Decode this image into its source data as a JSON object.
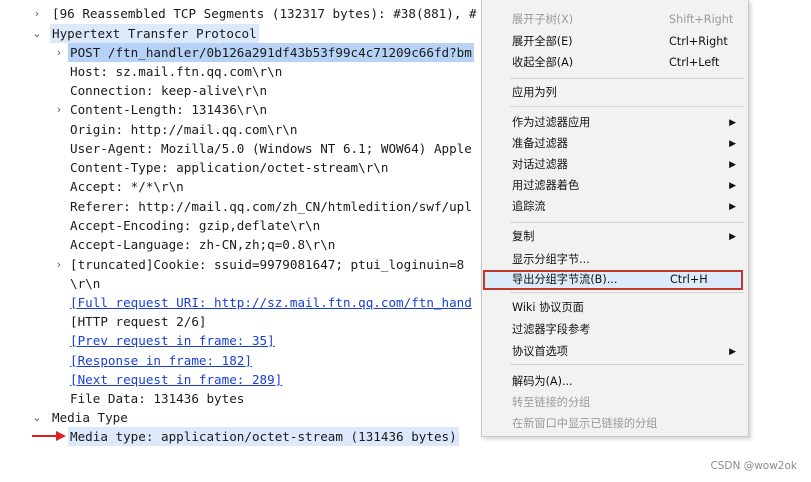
{
  "tree": [
    {
      "expander": "›",
      "text": "[96 Reassembled TCP Segments (132317 bytes): #38(881), #",
      "style": "plain"
    },
    {
      "expander": "⌄",
      "text": "Hypertext Transfer Protocol",
      "style": "sel-light"
    },
    {
      "expander": "›",
      "text": "POST /ftn_handler/0b126a291df43b53f99c4c71209c66fd?bm",
      "style": "sel-strong"
    },
    {
      "expander": "",
      "text": "Host: sz.mail.ftn.qq.com\\r\\n",
      "style": "plain"
    },
    {
      "expander": "",
      "text": "Connection: keep-alive\\r\\n",
      "style": "plain"
    },
    {
      "expander": "›",
      "text": "Content-Length: 131436\\r\\n",
      "style": "plain"
    },
    {
      "expander": "",
      "text": "Origin: http://mail.qq.com\\r\\n",
      "style": "plain"
    },
    {
      "expander": "",
      "text": "User-Agent: Mozilla/5.0 (Windows NT 6.1; WOW64) Apple",
      "style": "plain"
    },
    {
      "expander": "",
      "text": "Content-Type: application/octet-stream\\r\\n",
      "style": "plain"
    },
    {
      "expander": "",
      "text": "Accept: */*\\r\\n",
      "style": "plain"
    },
    {
      "expander": "",
      "text": "Referer: http://mail.qq.com/zh_CN/htmledition/swf/upl",
      "style": "plain"
    },
    {
      "expander": "",
      "text": "Accept-Encoding: gzip,deflate\\r\\n",
      "style": "plain"
    },
    {
      "expander": "",
      "text": "Accept-Language: zh-CN,zh;q=0.8\\r\\n",
      "style": "plain"
    },
    {
      "expander": "›",
      "text": " [truncated]Cookie: ssuid=9979081647; ptui_loginuin=8",
      "style": "plain"
    },
    {
      "expander": "",
      "text": "\\r\\n",
      "style": "plain"
    },
    {
      "expander": "",
      "text": "[Full request URI: http://sz.mail.ftn.qq.com/ftn_hand",
      "style": "link"
    },
    {
      "expander": "",
      "text": "[HTTP request 2/6]",
      "style": "plain"
    },
    {
      "expander": "",
      "text": "[Prev request in frame: 35]",
      "style": "link"
    },
    {
      "expander": "",
      "text": "[Response in frame: 182]",
      "style": "link"
    },
    {
      "expander": "",
      "text": "[Next request in frame: 289]",
      "style": "link"
    },
    {
      "expander": "",
      "text": "File Data: 131436 bytes",
      "style": "plain"
    },
    {
      "expander": "⌄",
      "text": "Media Type",
      "style": "plain"
    },
    {
      "expander": "",
      "text": "Media type: application/octet-stream (131436 bytes)",
      "style": "sel-light"
    }
  ],
  "menu": [
    {
      "label": "展开子树(X)",
      "shortcut": "Shift+Right",
      "disabled": true
    },
    {
      "label": "展开全部(E)",
      "shortcut": "Ctrl+Right"
    },
    {
      "label": "收起全部(A)",
      "shortcut": "Ctrl+Left"
    },
    {
      "sep": true
    },
    {
      "label": "应用为列"
    },
    {
      "sep": true
    },
    {
      "label": "作为过滤器应用",
      "submenu": true
    },
    {
      "label": "准备过滤器",
      "submenu": true
    },
    {
      "label": "对话过滤器",
      "submenu": true
    },
    {
      "label": "用过滤器着色",
      "submenu": true
    },
    {
      "label": "追踪流",
      "submenu": true
    },
    {
      "sep": true
    },
    {
      "label": "复制",
      "submenu": true
    },
    {
      "label": "显示分组字节..."
    },
    {
      "label": "导出分组字节流(B)...",
      "shortcut": "Ctrl+H",
      "highlighted": true
    },
    {
      "sep": true
    },
    {
      "label": "Wiki 协议页面"
    },
    {
      "label": "过滤器字段参考"
    },
    {
      "label": "协议首选项",
      "submenu": true
    },
    {
      "sep": true
    },
    {
      "label": "解码为(A)..."
    },
    {
      "label": "转至链接的分组",
      "disabled": true
    },
    {
      "label": "在新窗口中显示已链接的分组",
      "disabled": true
    }
  ],
  "watermark": "CSDN @wow2ok",
  "colors": {
    "selection": "#b6d3f7",
    "selection_light": "#dbe9fb",
    "link": "#1a3fd6",
    "highlight_border": "#c0392b",
    "pointer_arrow": "#e02020"
  },
  "icons": {
    "pointer": "red-arrow-icon",
    "expanded": "chevron-down-icon",
    "collapsed": "chevron-right-icon",
    "submenu": "submenu-arrow-icon"
  }
}
